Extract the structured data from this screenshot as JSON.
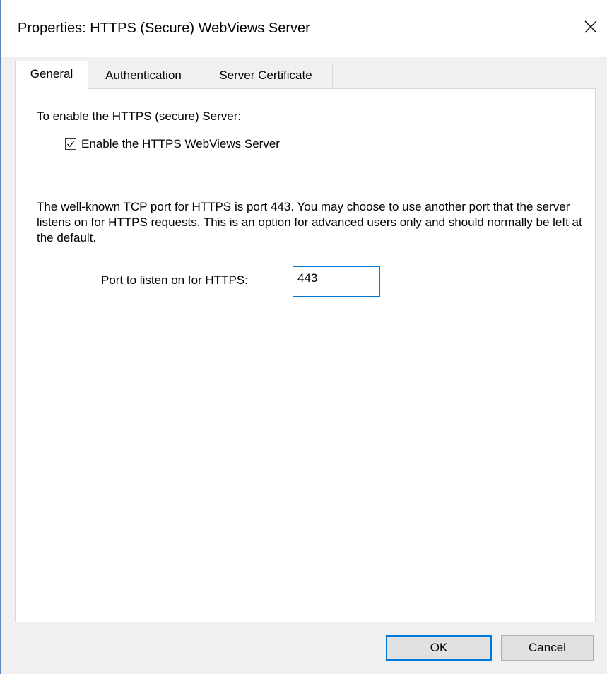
{
  "window": {
    "title": "Properties: HTTPS (Secure) WebViews Server"
  },
  "tabs": [
    {
      "label": "General",
      "active": true
    },
    {
      "label": "Authentication",
      "active": false
    },
    {
      "label": "Server Certificate",
      "active": false
    }
  ],
  "general": {
    "enable_heading": "To enable the HTTPS (secure) Server:",
    "enable_checkbox": {
      "label": "Enable the HTTPS WebViews Server",
      "checked": true
    },
    "port_description": "The well-known TCP port for HTTPS is port 443. You may choose to use another port that the server listens on for HTTPS requests. This is an option for advanced users only and should normally be left at the default.",
    "port_label": "Port to listen on for HTTPS:",
    "port_value": "443"
  },
  "buttons": {
    "ok": "OK",
    "cancel": "Cancel"
  },
  "colors": {
    "focus_accent": "#0078d7",
    "window_border": "#5a86b8"
  },
  "icons": {
    "close": "close-icon",
    "check": "checkmark-icon"
  }
}
